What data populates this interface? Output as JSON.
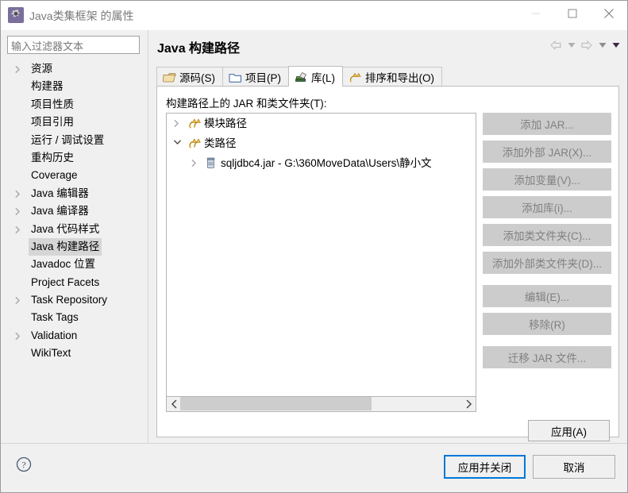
{
  "window": {
    "title": "Java类集框架 的属性",
    "icon": "gear-icon",
    "controls": {
      "minimize": "minimize-icon",
      "maximize": "maximize-icon",
      "close": "close-icon"
    }
  },
  "sidebar": {
    "filter": {
      "placeholder": "输入过滤器文本",
      "value": ""
    },
    "items": [
      {
        "label": "资源",
        "expandable": true,
        "selected": false
      },
      {
        "label": "构建器",
        "expandable": false,
        "selected": false
      },
      {
        "label": "项目性质",
        "expandable": false,
        "selected": false
      },
      {
        "label": "项目引用",
        "expandable": false,
        "selected": false
      },
      {
        "label": "运行 / 调试设置",
        "expandable": false,
        "selected": false
      },
      {
        "label": "重构历史",
        "expandable": false,
        "selected": false
      },
      {
        "label": "Coverage",
        "expandable": false,
        "selected": false
      },
      {
        "label": "Java 编辑器",
        "expandable": true,
        "selected": false
      },
      {
        "label": "Java 编译器",
        "expandable": true,
        "selected": false
      },
      {
        "label": "Java 代码样式",
        "expandable": true,
        "selected": false
      },
      {
        "label": "Java 构建路径",
        "expandable": false,
        "selected": true
      },
      {
        "label": "Javadoc 位置",
        "expandable": false,
        "selected": false
      },
      {
        "label": "Project Facets",
        "expandable": false,
        "selected": false
      },
      {
        "label": "Task Repository",
        "expandable": true,
        "selected": false
      },
      {
        "label": "Task Tags",
        "expandable": false,
        "selected": false
      },
      {
        "label": "Validation",
        "expandable": true,
        "selected": false
      },
      {
        "label": "WikiText",
        "expandable": false,
        "selected": false
      }
    ]
  },
  "page": {
    "title": "Java 构建路径",
    "nav": {
      "back": "back-arrow-icon",
      "back_menu": "chevron-down-icon",
      "forward": "forward-arrow-icon",
      "forward_menu": "chevron-down-icon",
      "view_menu": "chevron-down-icon"
    },
    "tabs": [
      {
        "label": "源码(S)",
        "icon": "source-folder-icon",
        "active": false
      },
      {
        "label": "项目(P)",
        "icon": "project-folder-icon",
        "active": false
      },
      {
        "label": "库(L)",
        "icon": "library-icon",
        "active": true
      },
      {
        "label": "排序和导出(O)",
        "icon": "order-export-icon",
        "active": false
      }
    ],
    "tree_label": "构建路径上的 JAR 和类文件夹(T):",
    "tree": [
      {
        "level": 1,
        "label": "模块路径",
        "icon": "path-entry-icon",
        "expanded": false,
        "expandable": true
      },
      {
        "level": 1,
        "label": "类路径",
        "icon": "path-entry-icon",
        "expanded": true,
        "expandable": true
      },
      {
        "level": 2,
        "label": "sqljdbc4.jar  -  G:\\360MoveData\\Users\\静小文",
        "icon": "jar-icon",
        "expanded": false,
        "expandable": true
      }
    ],
    "scrollbar": {
      "left_arrow": "chevron-left-icon",
      "right_arrow": "chevron-right-icon",
      "thumb_percent": 68
    },
    "side_buttons": [
      {
        "label": "添加 JAR...",
        "enabled": false,
        "gap_after": false
      },
      {
        "label": "添加外部 JAR(X)...",
        "enabled": false,
        "gap_after": false
      },
      {
        "label": "添加变量(V)...",
        "enabled": false,
        "gap_after": false
      },
      {
        "label": "添加库(i)...",
        "enabled": false,
        "gap_after": false
      },
      {
        "label": "添加类文件夹(C)...",
        "enabled": false,
        "gap_after": false
      },
      {
        "label": "添加外部类文件夹(D)...",
        "enabled": false,
        "gap_after": true
      },
      {
        "label": "编辑(E)...",
        "enabled": false,
        "gap_after": false
      },
      {
        "label": "移除(R)",
        "enabled": false,
        "gap_after": true
      },
      {
        "label": "迁移 JAR 文件...",
        "enabled": false,
        "gap_after": false
      }
    ],
    "apply_label": "应用(A)"
  },
  "footer": {
    "help": "help-icon",
    "apply_and_close": "应用并关闭",
    "cancel": "取消"
  },
  "colors": {
    "focus_blue": "#0078d7",
    "dialog_bg": "#f0f0f0",
    "selection_gray": "#d6d6d6",
    "disabled_btn": "#cccccc",
    "disabled_text": "#808080"
  }
}
